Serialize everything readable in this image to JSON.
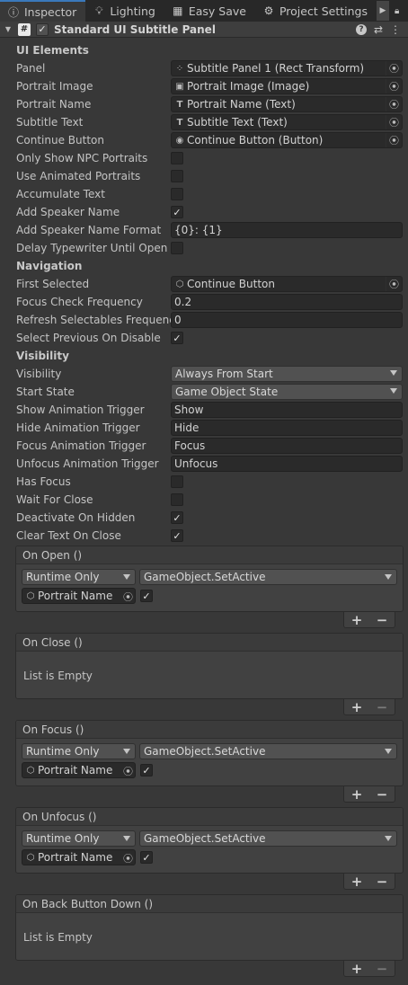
{
  "tabs": [
    {
      "label": "Inspector",
      "icon": "info-icon"
    },
    {
      "label": "Lighting",
      "icon": "lightbulb-icon"
    },
    {
      "label": "Easy Save",
      "icon": "save-icon"
    },
    {
      "label": "Project Settings",
      "icon": "gear-icon"
    }
  ],
  "component": {
    "title": "Standard UI Subtitle Panel",
    "enabled": true
  },
  "sections": {
    "ui_elements": "UI Elements",
    "navigation": "Navigation",
    "visibility": "Visibility"
  },
  "fields": {
    "panel": {
      "label": "Panel",
      "value": "Subtitle Panel 1 (Rect Transform)"
    },
    "portrait_image": {
      "label": "Portrait Image",
      "value": "Portrait Image (Image)"
    },
    "portrait_name": {
      "label": "Portrait Name",
      "value": "Portrait Name (Text)"
    },
    "subtitle_text": {
      "label": "Subtitle Text",
      "value": "Subtitle Text (Text)"
    },
    "continue_button": {
      "label": "Continue Button",
      "value": "Continue Button (Button)"
    },
    "only_show_npc": {
      "label": "Only Show NPC Portraits",
      "checked": false
    },
    "use_animated": {
      "label": "Use Animated Portraits",
      "checked": false
    },
    "accumulate_text": {
      "label": "Accumulate Text",
      "checked": false
    },
    "add_speaker_name": {
      "label": "Add Speaker Name",
      "checked": true
    },
    "speaker_name_format": {
      "label": "Add Speaker Name Format",
      "value": "{0}: {1}"
    },
    "delay_typewriter": {
      "label": "Delay Typewriter Until Open",
      "checked": false
    },
    "first_selected": {
      "label": "First Selected",
      "value": "Continue Button"
    },
    "focus_check_frequency": {
      "label": "Focus Check Frequency",
      "value": "0.2"
    },
    "refresh_selectables": {
      "label": "Refresh Selectables Frequency",
      "value": "0"
    },
    "select_previous": {
      "label": "Select Previous On Disable",
      "checked": true
    },
    "visibility": {
      "label": "Visibility",
      "value": "Always From Start"
    },
    "start_state": {
      "label": "Start State",
      "value": "Game Object State"
    },
    "show_anim_trigger": {
      "label": "Show Animation Trigger",
      "value": "Show"
    },
    "hide_anim_trigger": {
      "label": "Hide Animation Trigger",
      "value": "Hide"
    },
    "focus_anim_trigger": {
      "label": "Focus Animation Trigger",
      "value": "Focus"
    },
    "unfocus_anim_trigger": {
      "label": "Unfocus Animation Trigger",
      "value": "Unfocus"
    },
    "has_focus": {
      "label": "Has Focus",
      "checked": false
    },
    "wait_for_close": {
      "label": "Wait For Close",
      "checked": false
    },
    "deactivate_on_hidden": {
      "label": "Deactivate On Hidden",
      "checked": true
    },
    "clear_text_on_close": {
      "label": "Clear Text On Close",
      "checked": true
    }
  },
  "events": {
    "on_open": {
      "title": "On Open ()",
      "mode": "Runtime Only",
      "function": "GameObject.SetActive",
      "target": "Portrait Name",
      "arg_checked": true
    },
    "on_close": {
      "title": "On Close ()",
      "empty": "List is Empty"
    },
    "on_focus": {
      "title": "On Focus ()",
      "mode": "Runtime Only",
      "function": "GameObject.SetActive",
      "target": "Portrait Name",
      "arg_checked": true
    },
    "on_unfocus": {
      "title": "On Unfocus ()",
      "mode": "Runtime Only",
      "function": "GameObject.SetActive",
      "target": "Portrait Name",
      "arg_checked": true
    },
    "on_back_button_down": {
      "title": "On Back Button Down ()",
      "empty": "List is Empty"
    }
  },
  "glyphs": {
    "plus": "+",
    "minus": "−",
    "check": "✓",
    "picker": "⦿",
    "help": "?",
    "settings": "⇄",
    "menu": "⋮",
    "lock": "🔒",
    "more": "⋮",
    "arrow": "▶",
    "fold": "▼",
    "script": "#",
    "transform": "⁘",
    "image": "▣",
    "text": "T",
    "button": "◉",
    "gameobject": "⬡"
  }
}
